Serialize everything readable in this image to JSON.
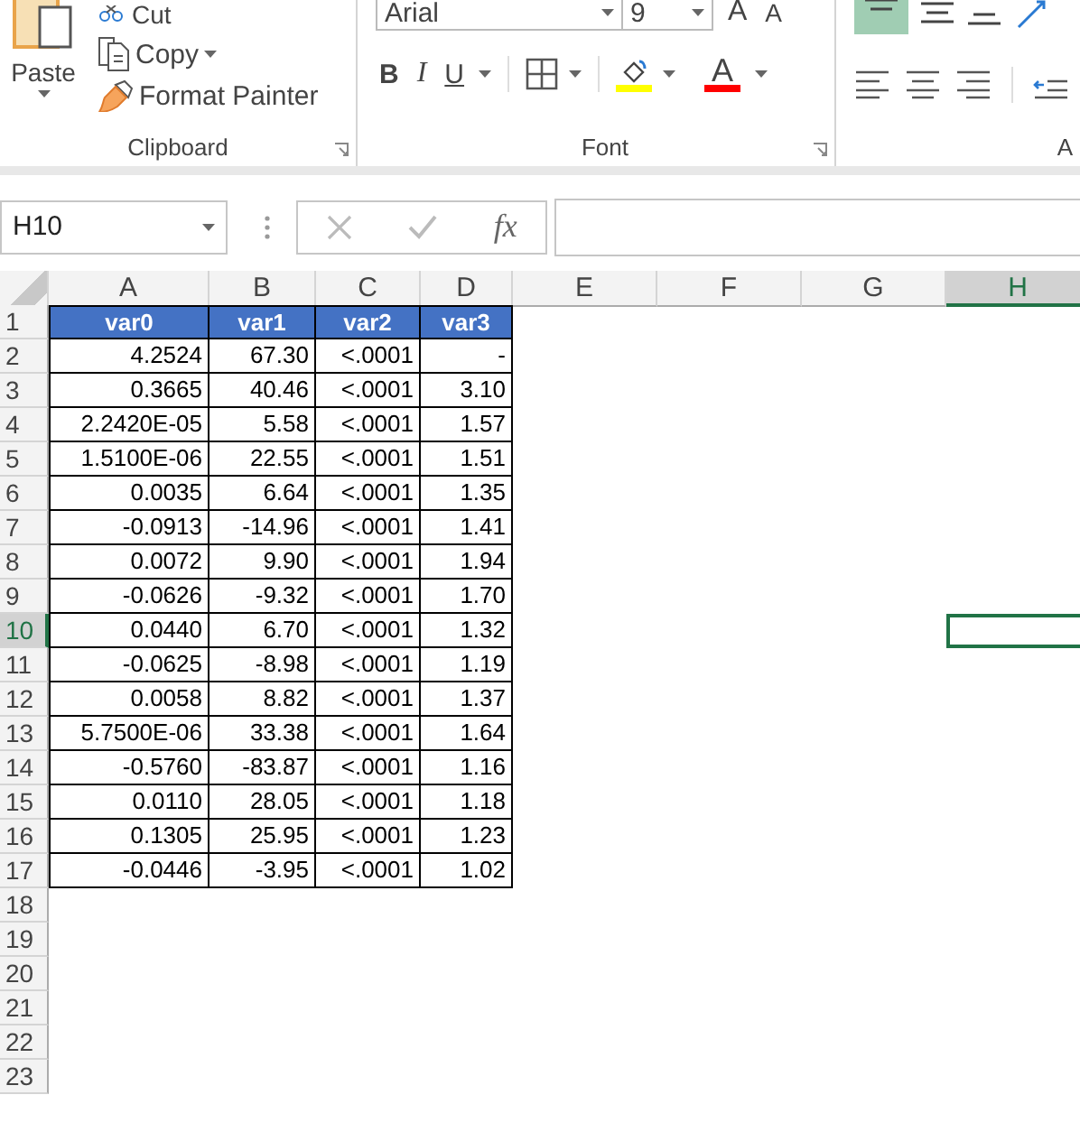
{
  "ribbon": {
    "clipboard": {
      "paste": "Paste",
      "cut": "Cut",
      "copy": "Copy",
      "format_painter": "Format Painter",
      "label": "Clipboard"
    },
    "font": {
      "name": "Arial",
      "size": "9",
      "grow": "A",
      "shrink": "A",
      "bold": "B",
      "italic": "I",
      "underline": "U",
      "font_color": "A",
      "label": "Font"
    },
    "alignment": {
      "label": "A",
      "top_align_selected": true
    }
  },
  "formula_bar": {
    "name_box": "H10",
    "function_label": "fx"
  },
  "sheet": {
    "columns": [
      {
        "label": "A",
        "selected": false
      },
      {
        "label": "B",
        "selected": false
      },
      {
        "label": "C",
        "selected": false
      },
      {
        "label": "D",
        "selected": false
      },
      {
        "label": "E",
        "selected": false
      },
      {
        "label": "F",
        "selected": false
      },
      {
        "label": "G",
        "selected": false
      },
      {
        "label": "H",
        "selected": true
      }
    ],
    "rows": [
      {
        "label": "1",
        "selected": false
      },
      {
        "label": "2",
        "selected": false
      },
      {
        "label": "3",
        "selected": false
      },
      {
        "label": "4",
        "selected": false
      },
      {
        "label": "5",
        "selected": false
      },
      {
        "label": "6",
        "selected": false
      },
      {
        "label": "7",
        "selected": false
      },
      {
        "label": "8",
        "selected": false
      },
      {
        "label": "9",
        "selected": false
      },
      {
        "label": "10",
        "selected": true
      },
      {
        "label": "11",
        "selected": false
      },
      {
        "label": "12",
        "selected": false
      },
      {
        "label": "13",
        "selected": false
      },
      {
        "label": "14",
        "selected": false
      },
      {
        "label": "15",
        "selected": false
      },
      {
        "label": "16",
        "selected": false
      },
      {
        "label": "17",
        "selected": false
      },
      {
        "label": "18",
        "selected": false
      },
      {
        "label": "19",
        "selected": false
      },
      {
        "label": "20",
        "selected": false
      },
      {
        "label": "21",
        "selected": false
      },
      {
        "label": "22",
        "selected": false
      },
      {
        "label": "23",
        "selected": false
      }
    ],
    "table": {
      "header": [
        "var0",
        "var1",
        "var2",
        "var3"
      ],
      "rows": [
        [
          "4.2524",
          "67.30",
          "<.0001",
          "-"
        ],
        [
          "0.3665",
          "40.46",
          "<.0001",
          "3.10"
        ],
        [
          "2.2420E-05",
          "5.58",
          "<.0001",
          "1.57"
        ],
        [
          "1.5100E-06",
          "22.55",
          "<.0001",
          "1.51"
        ],
        [
          "0.0035",
          "6.64",
          "<.0001",
          "1.35"
        ],
        [
          "-0.0913",
          "-14.96",
          "<.0001",
          "1.41"
        ],
        [
          "0.0072",
          "9.90",
          "<.0001",
          "1.94"
        ],
        [
          "-0.0626",
          "-9.32",
          "<.0001",
          "1.70"
        ],
        [
          "0.0440",
          "6.70",
          "<.0001",
          "1.32"
        ],
        [
          "-0.0625",
          "-8.98",
          "<.0001",
          "1.19"
        ],
        [
          "0.0058",
          "8.82",
          "<.0001",
          "1.37"
        ],
        [
          "5.7500E-06",
          "33.38",
          "<.0001",
          "1.64"
        ],
        [
          "-0.5760",
          "-83.87",
          "<.0001",
          "1.16"
        ],
        [
          "0.0110",
          "28.05",
          "<.0001",
          "1.18"
        ],
        [
          "0.1305",
          "25.95",
          "<.0001",
          "1.23"
        ],
        [
          "-0.0446",
          "-3.95",
          "<.0001",
          "1.02"
        ]
      ]
    }
  }
}
